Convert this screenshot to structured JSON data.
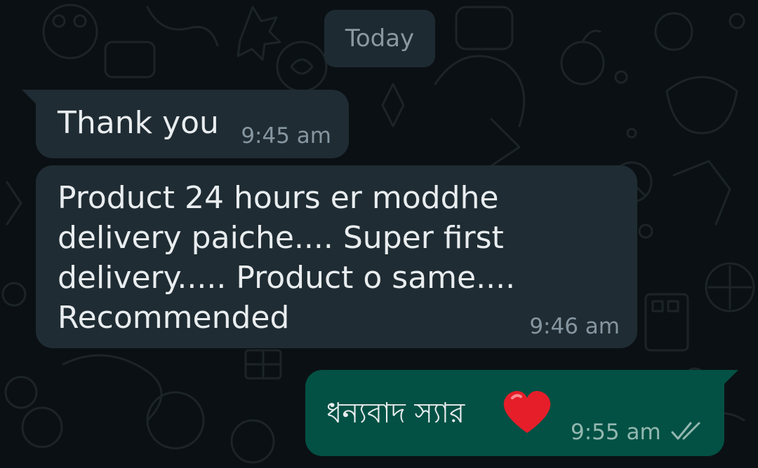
{
  "chat": {
    "date_separator": "Today",
    "messages": [
      {
        "direction": "incoming",
        "text": "Thank you",
        "time": "9:45 am"
      },
      {
        "direction": "incoming",
        "text": "Product 24 hours er moddhe delivery paiche.... Super first delivery..... Product o same.... Recommended",
        "time": "9:46 am"
      },
      {
        "direction": "outgoing",
        "text": "ধন্যবাদ স্যার",
        "emoji": "heart",
        "time": "9:55 am",
        "status": "read-double-check-icon"
      }
    ]
  },
  "theme": {
    "background": "#0b1014",
    "incoming_bubble": "#1f2c33",
    "outgoing_bubble": "#025144",
    "text": "#e9edef",
    "timestamp": "#8696a0",
    "heart": "#e51e2a"
  }
}
